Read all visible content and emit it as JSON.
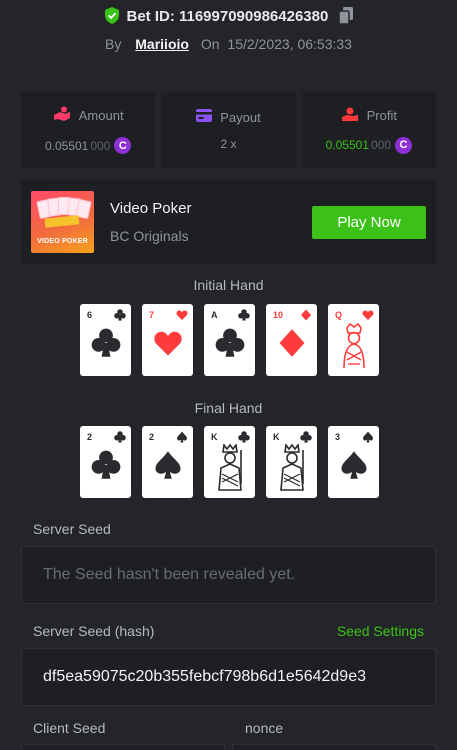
{
  "bet": {
    "id_label": "Bet ID: 116997090986426380",
    "by_label": "By",
    "username": "Mariioio",
    "on_label": "On",
    "timestamp": "15/2/2023, 06:53:33"
  },
  "stats": {
    "amount": {
      "label": "Amount",
      "value_main": "0.05501",
      "value_dim": "000",
      "coin_symbol": "C"
    },
    "payout": {
      "label": "Payout",
      "value": "2 x"
    },
    "profit": {
      "label": "Profit",
      "value_main": "0.05501",
      "value_dim": "000",
      "coin_symbol": "C"
    }
  },
  "game": {
    "name": "Video Poker",
    "provider": "BC Originals",
    "thumb_label": "VIDEO POKER",
    "play_button": "Play Now"
  },
  "initial_hand": {
    "title": "Initial Hand",
    "cards": [
      {
        "rank": "6",
        "suit": "clubs",
        "color": "black"
      },
      {
        "rank": "7",
        "suit": "hearts",
        "color": "red"
      },
      {
        "rank": "A",
        "suit": "clubs",
        "color": "black"
      },
      {
        "rank": "10",
        "suit": "diamonds",
        "color": "red"
      },
      {
        "rank": "Q",
        "suit": "hearts",
        "color": "red"
      }
    ]
  },
  "final_hand": {
    "title": "Final Hand",
    "cards": [
      {
        "rank": "2",
        "suit": "clubs",
        "color": "black"
      },
      {
        "rank": "2",
        "suit": "spades",
        "color": "black"
      },
      {
        "rank": "K",
        "suit": "clubs",
        "color": "black"
      },
      {
        "rank": "K",
        "suit": "clubs",
        "color": "black"
      },
      {
        "rank": "3",
        "suit": "spades",
        "color": "black"
      }
    ]
  },
  "seeds": {
    "server_seed_label": "Server Seed",
    "server_seed_value": "The Seed hasn't been revealed yet.",
    "server_hash_label": "Server Seed (hash)",
    "seed_settings_link": "Seed Settings",
    "server_hash_value": "df5ea59075c20b355febcf798b6d1e5642d9e3",
    "client_seed_label": "Client Seed",
    "nonce_label": "nonce"
  },
  "colors": {
    "background": "#232528",
    "panel": "#1d1f22",
    "accent_green": "#3bc117",
    "coin_purple": "#8d2fd5",
    "red_suit": "#ff3a3a"
  }
}
